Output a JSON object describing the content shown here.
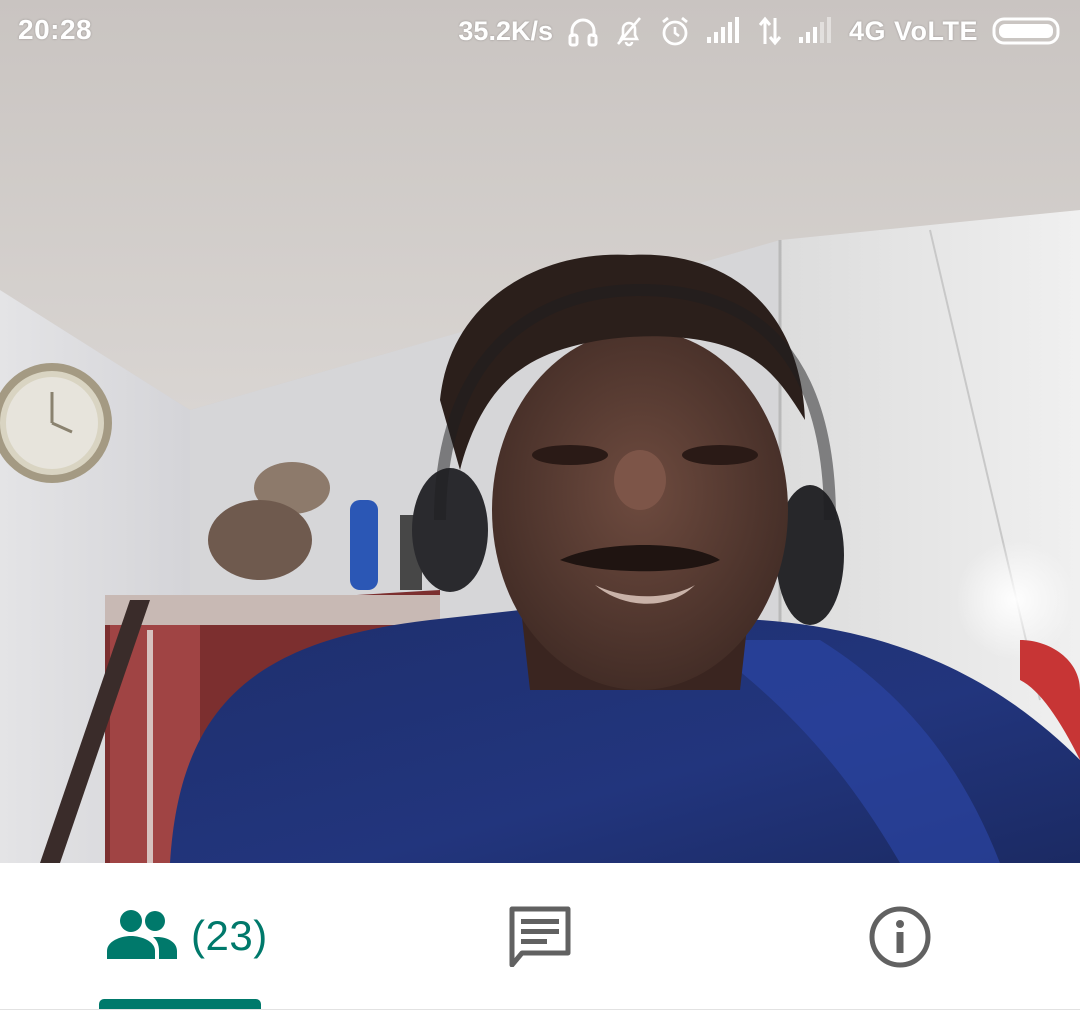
{
  "status_bar": {
    "time": "20:28",
    "network_speed": "35.2K/s",
    "network_type": "4G VoLTE",
    "icons": [
      "headphones-icon",
      "notifications-off-icon",
      "alarm-icon",
      "signal-icon",
      "data-arrows-icon",
      "signal-weak-icon",
      "battery-icon"
    ]
  },
  "video": {
    "description_icon": "camera-feed"
  },
  "tabs": {
    "participants": {
      "icon": "people-icon",
      "count_label": "(23)",
      "selected": true
    },
    "chat": {
      "icon": "chat-icon"
    },
    "info": {
      "icon": "info-icon"
    }
  },
  "colors": {
    "accent": "#00796b",
    "icon_gray": "#616161",
    "tab_background": "#ffffff"
  }
}
